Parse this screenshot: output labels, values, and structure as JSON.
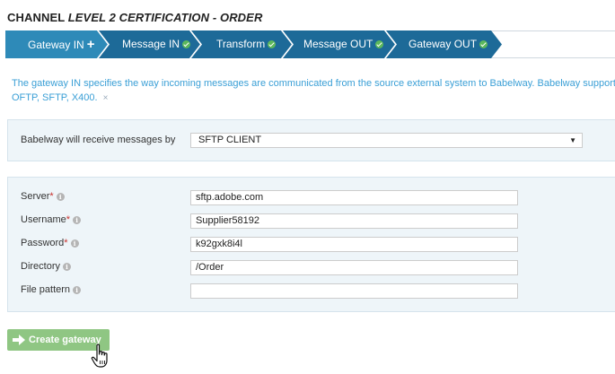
{
  "header": {
    "title_prefix": "CHANNEL ",
    "title_italic": "LEVEL 2 CERTIFICATION - ORDER"
  },
  "steps": [
    {
      "label": "Gateway IN",
      "state": "active",
      "icon": "plus-icon"
    },
    {
      "label": "Message IN",
      "state": "done",
      "icon": "check-icon"
    },
    {
      "label": "Transform",
      "state": "done",
      "icon": "check-icon"
    },
    {
      "label": "Message OUT",
      "state": "done",
      "icon": "check-icon"
    },
    {
      "label": "Gateway OUT",
      "state": "done",
      "icon": "check-icon"
    }
  ],
  "info": {
    "line1": "The gateway IN specifies the way incoming messages are communicated from the source external system to Babelway. Babelway supports a",
    "line2": "OFTP, SFTP, X400.",
    "close": "×"
  },
  "receive": {
    "label": "Babelway will receive messages by",
    "value": "SFTP CLIENT"
  },
  "fields": [
    {
      "label": "Server",
      "required": true,
      "value": "sftp.adobe.com"
    },
    {
      "label": "Username",
      "required": true,
      "value": "Supplier58192"
    },
    {
      "label": "Password",
      "required": true,
      "value": "k92gxk8i4l"
    },
    {
      "label": "Directory",
      "required": false,
      "value": "/Order"
    },
    {
      "label": "File pattern",
      "required": false,
      "value": ""
    }
  ],
  "required_mark": "*",
  "info_icon_glyph": "i",
  "create_button": {
    "label": "Create gateway"
  },
  "colors": {
    "active_step": "#2e8ab8",
    "step": "#1d6a98",
    "info_text": "#3a9fd6",
    "button": "#8fc683",
    "check": "#5cb85c"
  }
}
